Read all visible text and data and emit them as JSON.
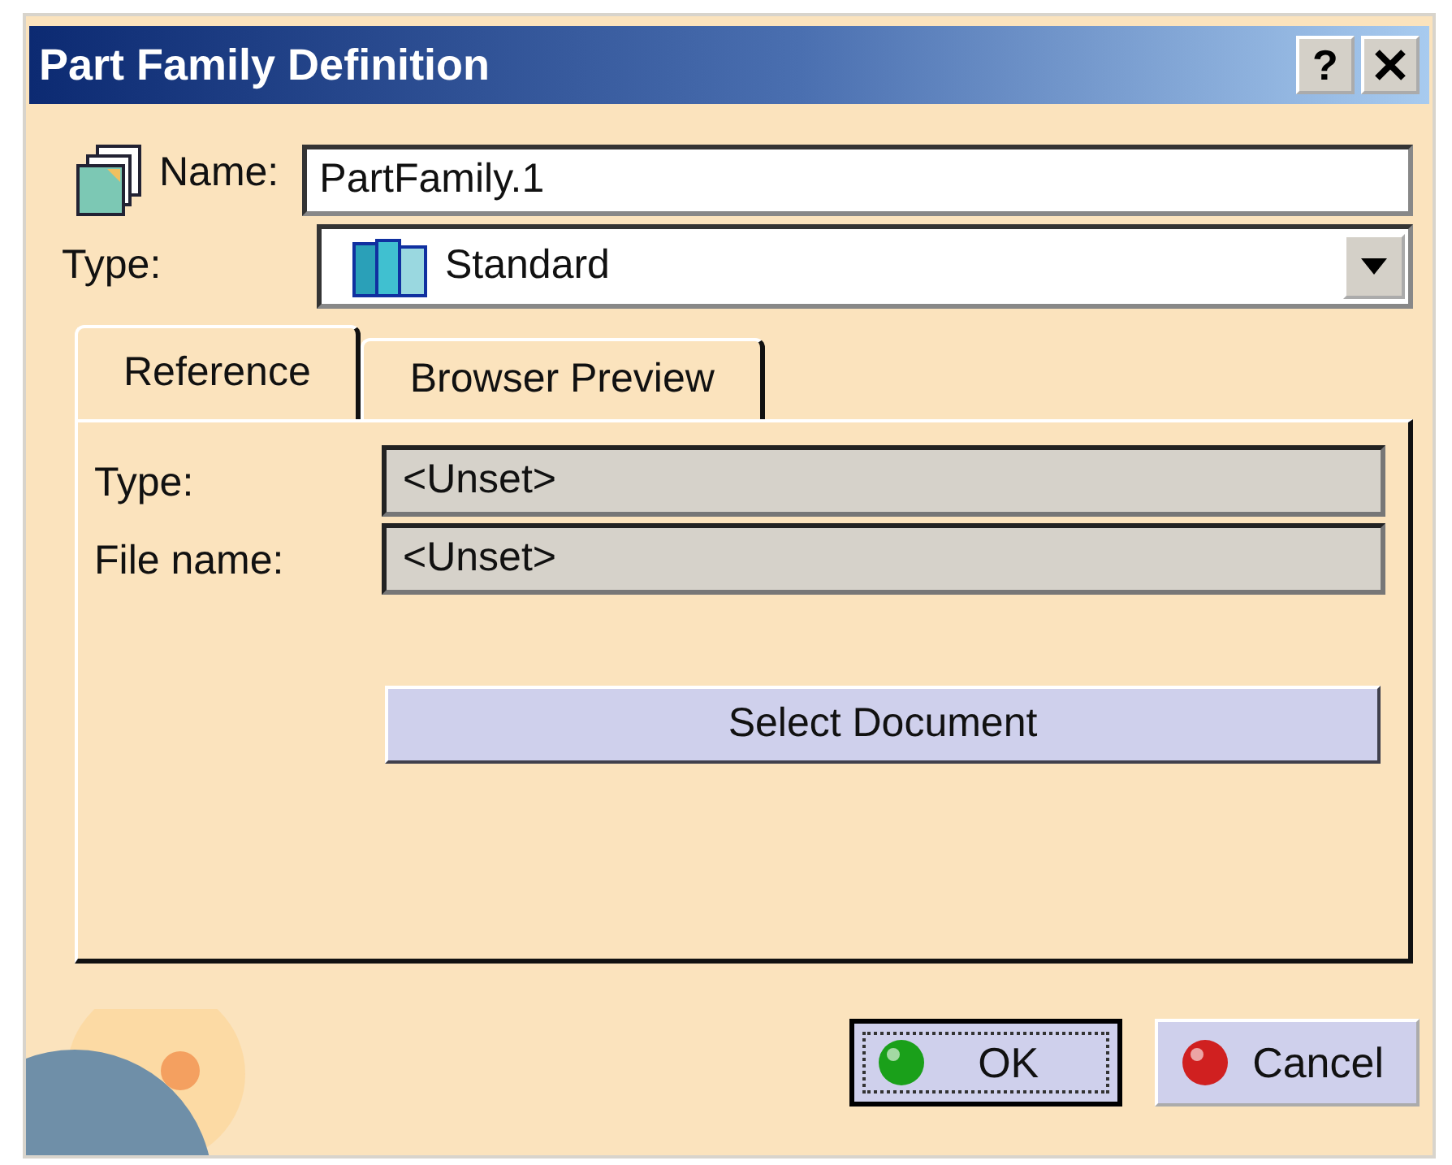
{
  "window": {
    "title": "Part Family Definition",
    "help_button": "?"
  },
  "name_field": {
    "label": "Name:",
    "value": "PartFamily.1"
  },
  "type_combo": {
    "label": "Type:",
    "value": "Standard"
  },
  "tabs": [
    {
      "label": "Reference",
      "selected": true
    },
    {
      "label": "Browser Preview",
      "selected": false
    }
  ],
  "reference": {
    "fields": [
      {
        "label": "Type:",
        "value": "<Unset>"
      },
      {
        "label": "File name:",
        "value": "<Unset>"
      }
    ],
    "select_button": "Select Document"
  },
  "buttons": [
    {
      "label": "OK",
      "kind": "ok",
      "default": true
    },
    {
      "label": "Cancel",
      "kind": "cancel",
      "default": false
    }
  ]
}
